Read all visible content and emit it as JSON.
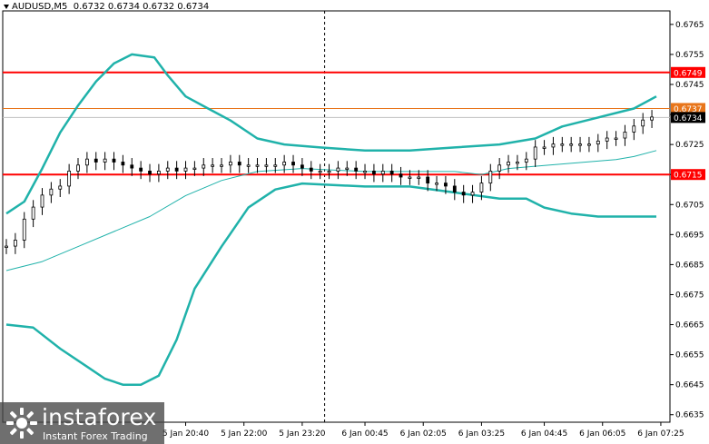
{
  "header": {
    "symbol": "AUDUSD,M5",
    "ohlc": "0.6732 0.6734 0.6732 0.6734"
  },
  "logo": {
    "brand": "instaforex",
    "tagline": "Instant Forex Trading"
  },
  "colors": {
    "candles": "#000000",
    "bollinger": "#20B2AA",
    "ma": "#20B2AA",
    "support_resistance": "#FF0000",
    "current_level": "#E8751A",
    "price_label_bg": "#000000"
  },
  "chart_data": {
    "type": "line",
    "title": "",
    "xlabel": "",
    "ylabel": "",
    "ylim": [
      0.66325,
      0.67695
    ],
    "y_ticks": [
      "0.6765",
      "0.6755",
      "0.6745",
      "0.6735",
      "0.6725",
      "0.6715",
      "0.6705",
      "0.6695",
      "0.6685",
      "0.6675",
      "0.6665",
      "0.6655",
      "0.6645",
      "0.6635"
    ],
    "x_ticks": [
      "5 Jan 20:40",
      "5 Jan 22:00",
      "5 Jan 23:20",
      "6 Jan 00:45",
      "6 Jan 02:05",
      "6 Jan 03:25",
      "6 Jan 04:45",
      "6 Jan 06:05",
      "6 Jan 07:25"
    ],
    "x_range": [
      0,
      145
    ],
    "x_tick_index": [
      40,
      53,
      66,
      80,
      93,
      106,
      120,
      133,
      146
    ],
    "vertical_marker_index": 71,
    "horizontal_levels": [
      {
        "value": 0.6749,
        "label": "0.6749",
        "kind": "resistance"
      },
      {
        "value": 0.6715,
        "label": "0.6715",
        "kind": "support"
      },
      {
        "value": 0.6737,
        "label": "0.6737",
        "kind": "level"
      }
    ],
    "current_price": {
      "value": 0.6734,
      "label": "0.6734"
    },
    "series": [
      {
        "role": "upper_band",
        "points": [
          [
            0,
            0.6702
          ],
          [
            4,
            0.6706
          ],
          [
            8,
            0.6717
          ],
          [
            12,
            0.6729
          ],
          [
            16,
            0.6738
          ],
          [
            20,
            0.6746
          ],
          [
            24,
            0.6752
          ],
          [
            28,
            0.6755
          ],
          [
            33,
            0.6754
          ],
          [
            36,
            0.6748
          ],
          [
            40,
            0.6741
          ],
          [
            45,
            0.6737
          ],
          [
            50,
            0.6733
          ],
          [
            56,
            0.6727
          ],
          [
            62,
            0.6725
          ],
          [
            70,
            0.6724
          ],
          [
            80,
            0.6723
          ],
          [
            90,
            0.6723
          ],
          [
            100,
            0.6724
          ],
          [
            110,
            0.6725
          ],
          [
            118,
            0.6727
          ],
          [
            124,
            0.6731
          ],
          [
            132,
            0.6734
          ],
          [
            140,
            0.6737
          ],
          [
            145,
            0.6741
          ]
        ]
      },
      {
        "role": "lower_band",
        "points": [
          [
            0,
            0.6665
          ],
          [
            6,
            0.6664
          ],
          [
            12,
            0.6657
          ],
          [
            18,
            0.6651
          ],
          [
            22,
            0.6647
          ],
          [
            26,
            0.6645
          ],
          [
            30,
            0.6645
          ],
          [
            34,
            0.6648
          ],
          [
            38,
            0.666
          ],
          [
            42,
            0.6677
          ],
          [
            48,
            0.6691
          ],
          [
            54,
            0.6704
          ],
          [
            60,
            0.671
          ],
          [
            66,
            0.6712
          ],
          [
            80,
            0.6711
          ],
          [
            90,
            0.6711
          ],
          [
            100,
            0.6709
          ],
          [
            110,
            0.6707
          ],
          [
            116,
            0.6707
          ],
          [
            120,
            0.6704
          ],
          [
            126,
            0.6702
          ],
          [
            132,
            0.6701
          ],
          [
            140,
            0.6701
          ],
          [
            145,
            0.6701
          ]
        ]
      },
      {
        "role": "moving_average",
        "points": [
          [
            0,
            0.6683
          ],
          [
            8,
            0.6686
          ],
          [
            16,
            0.6691
          ],
          [
            24,
            0.6696
          ],
          [
            32,
            0.6701
          ],
          [
            40,
            0.6708
          ],
          [
            48,
            0.6713
          ],
          [
            56,
            0.6716
          ],
          [
            66,
            0.6717
          ],
          [
            80,
            0.6716
          ],
          [
            90,
            0.6716
          ],
          [
            100,
            0.6716
          ],
          [
            106,
            0.6715
          ],
          [
            112,
            0.6717
          ],
          [
            120,
            0.6718
          ],
          [
            128,
            0.6719
          ],
          [
            136,
            0.672
          ],
          [
            140,
            0.6721
          ],
          [
            145,
            0.6723
          ]
        ]
      },
      {
        "role": "candles",
        "points": [
          [
            0,
            0.6691
          ],
          [
            2,
            0.6693
          ],
          [
            4,
            0.67
          ],
          [
            6,
            0.6704
          ],
          [
            8,
            0.6708
          ],
          [
            10,
            0.671
          ],
          [
            12,
            0.6711
          ],
          [
            14,
            0.6716
          ],
          [
            16,
            0.6718
          ],
          [
            18,
            0.672
          ],
          [
            20,
            0.6719
          ],
          [
            22,
            0.672
          ],
          [
            24,
            0.6719
          ],
          [
            26,
            0.6718
          ],
          [
            28,
            0.6717
          ],
          [
            30,
            0.6716
          ],
          [
            32,
            0.6715
          ],
          [
            34,
            0.6716
          ],
          [
            36,
            0.6717
          ],
          [
            38,
            0.6716
          ],
          [
            40,
            0.6717
          ],
          [
            42,
            0.6717
          ],
          [
            44,
            0.6718
          ],
          [
            46,
            0.6718
          ],
          [
            48,
            0.6718
          ],
          [
            50,
            0.6719
          ],
          [
            52,
            0.6718
          ],
          [
            54,
            0.6718
          ],
          [
            56,
            0.6718
          ],
          [
            58,
            0.6718
          ],
          [
            60,
            0.6718
          ],
          [
            62,
            0.6719
          ],
          [
            64,
            0.6718
          ],
          [
            66,
            0.6717
          ],
          [
            68,
            0.6716
          ],
          [
            70,
            0.6716
          ],
          [
            72,
            0.6716
          ],
          [
            74,
            0.6717
          ],
          [
            76,
            0.6717
          ],
          [
            78,
            0.6716
          ],
          [
            80,
            0.6716
          ],
          [
            82,
            0.6715
          ],
          [
            84,
            0.6716
          ],
          [
            86,
            0.6715
          ],
          [
            88,
            0.6714
          ],
          [
            90,
            0.6714
          ],
          [
            92,
            0.6714
          ],
          [
            94,
            0.6712
          ],
          [
            96,
            0.6712
          ],
          [
            98,
            0.6711
          ],
          [
            100,
            0.6709
          ],
          [
            102,
            0.6708
          ],
          [
            104,
            0.6709
          ],
          [
            106,
            0.6712
          ],
          [
            108,
            0.6716
          ],
          [
            110,
            0.6718
          ],
          [
            112,
            0.6719
          ],
          [
            114,
            0.6719
          ],
          [
            116,
            0.672
          ],
          [
            118,
            0.6724
          ],
          [
            120,
            0.6724
          ],
          [
            122,
            0.6725
          ],
          [
            124,
            0.6725
          ],
          [
            126,
            0.6725
          ],
          [
            128,
            0.6725
          ],
          [
            130,
            0.6725
          ],
          [
            132,
            0.6726
          ],
          [
            134,
            0.6727
          ],
          [
            136,
            0.6727
          ],
          [
            138,
            0.6729
          ],
          [
            140,
            0.6731
          ],
          [
            142,
            0.6733
          ],
          [
            144,
            0.6734
          ]
        ]
      }
    ]
  }
}
